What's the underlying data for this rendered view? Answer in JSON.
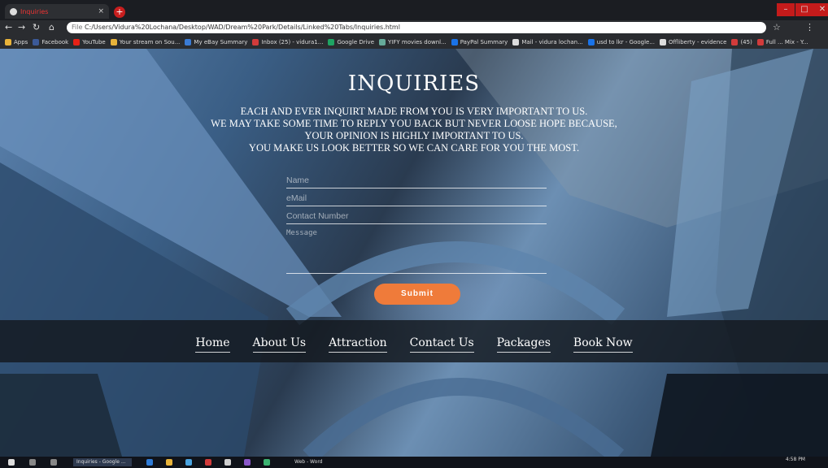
{
  "browser": {
    "tab_title": "Inquiries",
    "tab_close": "×",
    "new_tab": "+",
    "address": "C:/Users/Vidura%20Lochana/Desktop/WAD/Dream%20Park/Details/Linked%20Tabs/Inquiries.html",
    "address_scheme": "File",
    "bookmarks": [
      "Apps",
      "Facebook",
      "YouTube",
      "Your stream on Sou...",
      "My eBay Summary",
      "Inbox (25) - vidura1...",
      "Google Drive",
      "YIFY movies downl...",
      "PayPal Summary",
      "Mail - vidura lochan...",
      "usd to lkr - Google...",
      "Offliberty - evidence",
      "(45)",
      "Full ... Mix - Y..."
    ]
  },
  "page": {
    "title": "INQUIRIES",
    "paragraph_lines": [
      "EACH AND EVER INQUIRT MADE FROM YOU IS VERY IMPORTANT TO US.",
      "WE MAY TAKE SOME TIME TO REPLY YOU BACK BUT NEVER LOOSE HOPE BECAUSE,",
      "YOUR OPINION IS HIGHLY IMPORTANT TO US.",
      "YOU MAKE US LOOK BETTER SO WE CAN CARE FOR YOU THE MOST."
    ],
    "form": {
      "name_placeholder": "Name",
      "email_placeholder": "eMail",
      "contact_placeholder": "Contact Number",
      "message_placeholder": "Message",
      "submit_label": "Submit"
    },
    "nav": [
      "Home",
      "About Us",
      "Attraction",
      "Contact Us",
      "Packages",
      "Book Now"
    ]
  },
  "taskbar": {
    "chrome_label": "Inquiries - Google ...",
    "word_label": "Web - Word",
    "time": "4:58 PM"
  },
  "colors": {
    "accent": "#ef7b3a"
  }
}
